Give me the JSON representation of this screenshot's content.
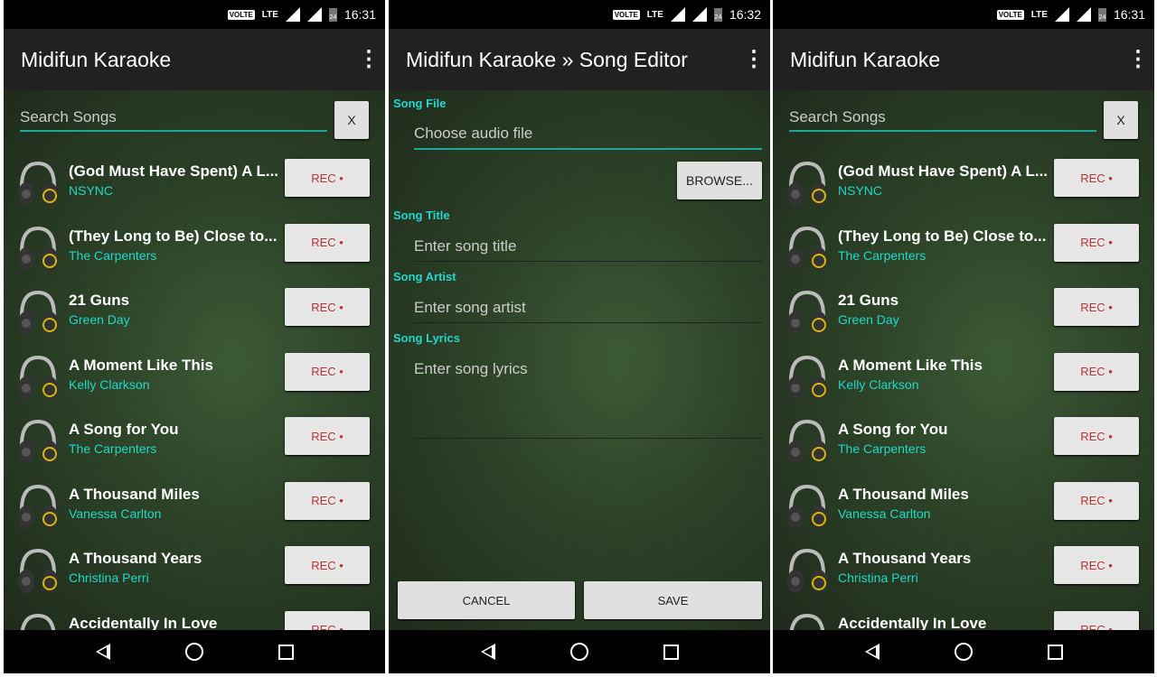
{
  "status_bars": [
    {
      "time": "16:31"
    },
    {
      "time": "16:32"
    },
    {
      "time": "16:31"
    }
  ],
  "status": {
    "volte": "VOLTE",
    "lte": "LTE",
    "battery": "24"
  },
  "list_screen": {
    "app_title": "Midifun Karaoke",
    "search_placeholder": "Search Songs",
    "clear_label": "X",
    "rec_label": "REC •",
    "songs": [
      {
        "title": "(God Must Have Spent) A L...",
        "artist": "NSYNC"
      },
      {
        "title": "(They Long to Be) Close to...",
        "artist": "The Carpenters"
      },
      {
        "title": "21 Guns",
        "artist": "Green Day"
      },
      {
        "title": "A Moment Like This",
        "artist": "Kelly Clarkson"
      },
      {
        "title": "A Song for You",
        "artist": "The Carpenters"
      },
      {
        "title": "A Thousand Miles",
        "artist": "Vanessa Carlton"
      },
      {
        "title": "A Thousand Years",
        "artist": "Christina Perri"
      },
      {
        "title": "Accidentally In Love",
        "artist": ""
      }
    ]
  },
  "editor": {
    "app_title": "Midifun Karaoke » Song Editor",
    "song_file_label": "Song File",
    "song_file_placeholder": "Choose audio file",
    "browse_label": "BROWSE...",
    "song_title_label": "Song Title",
    "song_title_placeholder": "Enter song title",
    "song_artist_label": "Song Artist",
    "song_artist_placeholder": "Enter song artist",
    "song_lyrics_label": "Song Lyrics",
    "song_lyrics_placeholder": "Enter song lyrics",
    "cancel_label": "CANCEL",
    "save_label": "SAVE"
  },
  "colors": {
    "accent": "#1fd8c8",
    "rec": "#b33333",
    "appbar": "#212121"
  }
}
